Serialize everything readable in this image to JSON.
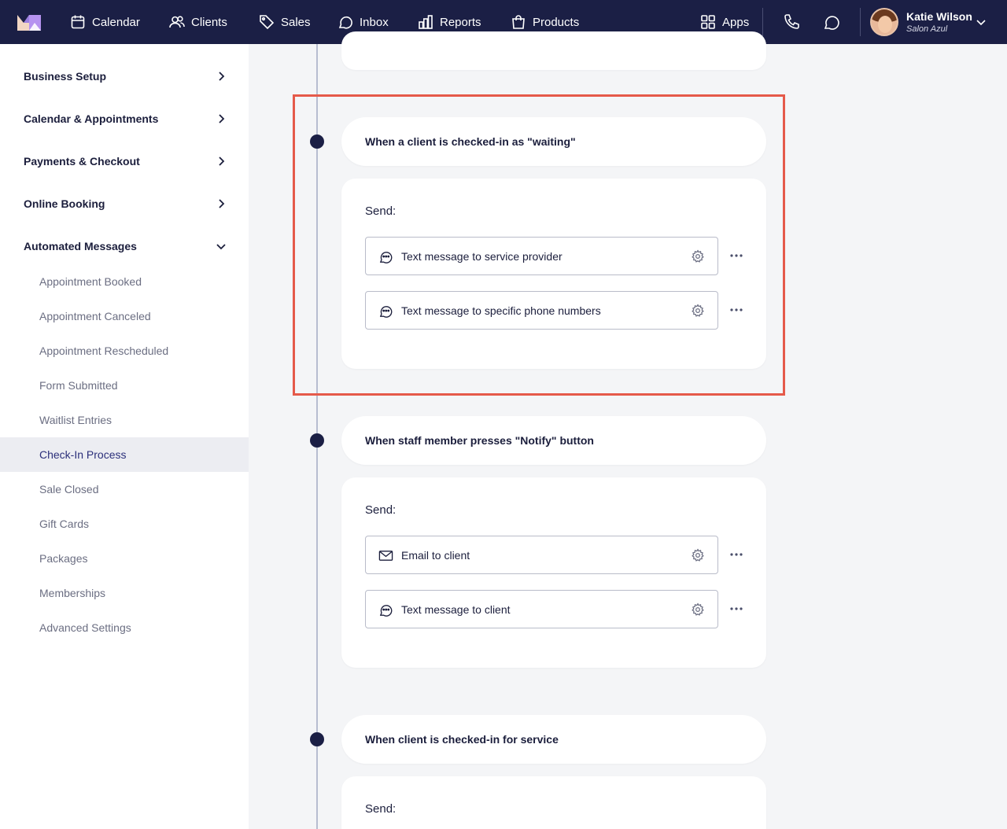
{
  "topnav": {
    "items": [
      {
        "label": "Calendar",
        "icon": "calendar-icon"
      },
      {
        "label": "Clients",
        "icon": "clients-icon"
      },
      {
        "label": "Sales",
        "icon": "tag-icon"
      },
      {
        "label": "Inbox",
        "icon": "inbox-icon"
      },
      {
        "label": "Reports",
        "icon": "reports-icon"
      },
      {
        "label": "Products",
        "icon": "bag-icon"
      }
    ],
    "apps_label": "Apps",
    "user": {
      "name": "Katie Wilson",
      "business": "Salon Azul"
    }
  },
  "sidebar": {
    "sections": [
      {
        "label": "Business Setup",
        "expanded": false
      },
      {
        "label": "Calendar & Appointments",
        "expanded": false
      },
      {
        "label": "Payments & Checkout",
        "expanded": false
      },
      {
        "label": "Online Booking",
        "expanded": false
      },
      {
        "label": "Automated Messages",
        "expanded": true
      }
    ],
    "subitems": [
      {
        "label": "Appointment Booked",
        "active": false
      },
      {
        "label": "Appointment Canceled",
        "active": false
      },
      {
        "label": "Appointment Rescheduled",
        "active": false
      },
      {
        "label": "Form Submitted",
        "active": false
      },
      {
        "label": "Waitlist Entries",
        "active": false
      },
      {
        "label": "Check-In Process",
        "active": true
      },
      {
        "label": "Sale Closed",
        "active": false
      },
      {
        "label": "Gift Cards",
        "active": false
      },
      {
        "label": "Packages",
        "active": false
      },
      {
        "label": "Memberships",
        "active": false
      },
      {
        "label": "Advanced Settings",
        "active": false
      }
    ]
  },
  "triggers": [
    {
      "title": "When a client is checked-in as \"waiting\"",
      "send_label": "Send:",
      "actions": [
        {
          "label": "Text message to service provider",
          "icon": "chat-bubble-icon"
        },
        {
          "label": "Text message to specific phone numbers",
          "icon": "chat-bubble-icon"
        }
      ]
    },
    {
      "title": "When staff member presses \"Notify\" button",
      "send_label": "Send:",
      "actions": [
        {
          "label": "Email to client",
          "icon": "envelope-icon"
        },
        {
          "label": "Text message to client",
          "icon": "chat-bubble-icon"
        }
      ]
    },
    {
      "title": "When client is checked-in for service",
      "send_label": "Send:",
      "actions": []
    }
  ],
  "colors": {
    "nav_bg": "#1b1f45",
    "highlight": "#e55a4a",
    "active_bg": "#ecedf2",
    "accent": "#2b2f7a"
  }
}
